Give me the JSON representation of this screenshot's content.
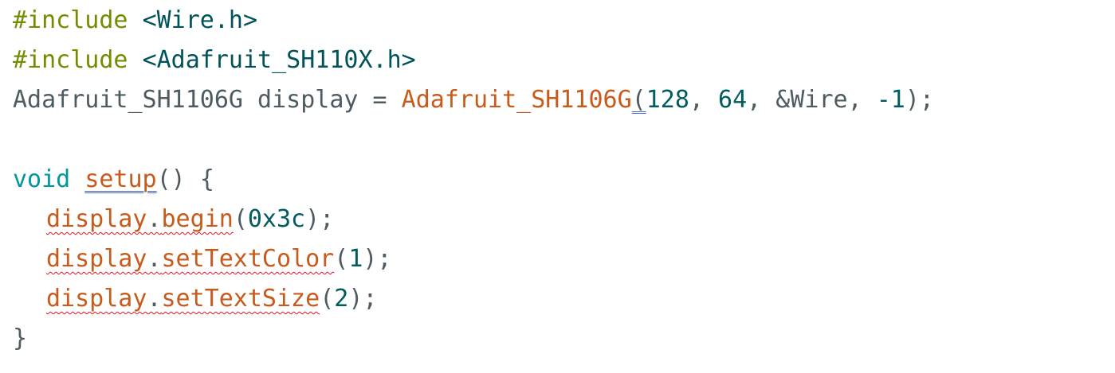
{
  "editor": {
    "colors": {
      "background": "#ffffff",
      "directive": "#728e00",
      "header": "#00535b",
      "plain": "#4e5b61",
      "function": "#c85a1b",
      "number": "#005c5f",
      "keyword": "#00979d",
      "spelling_squiggle": "#e81123",
      "grammar_double_underline": "#4a64c8"
    },
    "lines": [
      {
        "directive": "#include",
        "header": "<Wire.h>"
      },
      {
        "directive": "#include",
        "header": "<Adafruit_SH110X.h>"
      },
      {
        "type": "Adafruit_SH1106G",
        "name": "display",
        "assign": "=",
        "ctor": "Adafruit_SH1106G",
        "open": "(",
        "arg1": "128",
        "comma1": ",",
        "arg2": "64",
        "comma2": ",",
        "arg3": "&Wire",
        "comma3": ",",
        "arg4": "-1",
        "close": ");"
      },
      {},
      {
        "keyword": "void",
        "func": "setup",
        "parens": "()",
        "brace": "{"
      },
      {
        "object": "display",
        "dot": ".",
        "method": "begin",
        "open": "(",
        "arg": "0x3c",
        "close": ");"
      },
      {
        "object": "display",
        "dot": ".",
        "method": "setTextColor",
        "open": "(",
        "arg": "1",
        "close": ");"
      },
      {
        "object": "display",
        "dot": ".",
        "method": "setTextSize",
        "open": "(",
        "arg": "2",
        "close": ");"
      },
      {
        "brace": "}"
      }
    ]
  }
}
